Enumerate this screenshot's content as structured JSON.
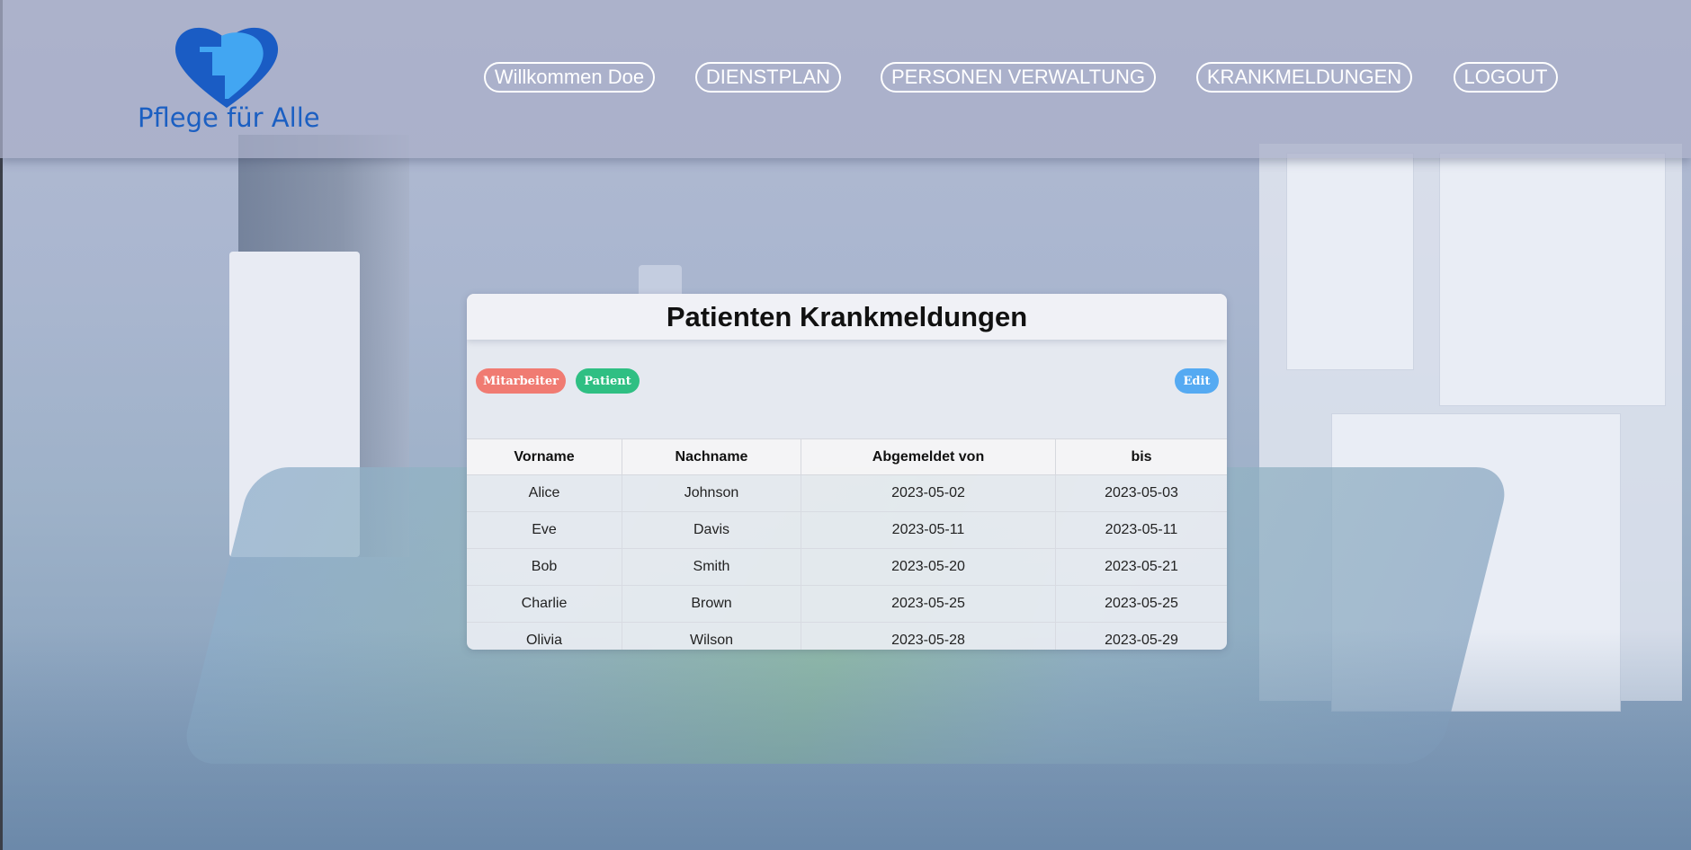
{
  "brand": {
    "name": "Pflege für Alle",
    "colors": {
      "heart_dark": "#1a5cc4",
      "heart_light": "#42a6f2",
      "text": "#1b5fc2"
    }
  },
  "nav": {
    "items": [
      {
        "label": "Willkommen Doe"
      },
      {
        "label": "DIENSTPLAN"
      },
      {
        "label": "PERSONEN VERWALTUNG"
      },
      {
        "label": "KRANKMELDUNGEN"
      },
      {
        "label": "LOGOUT"
      }
    ]
  },
  "card": {
    "title": "Patienten Krankmeldungen",
    "filters": {
      "mitarbeiter": {
        "label": "Mitarbeiter",
        "color": "#f07b72"
      },
      "patient": {
        "label": "Patient",
        "color": "#2fbf83"
      }
    },
    "edit": {
      "label": "Edit",
      "color": "#55aaf2"
    }
  },
  "table": {
    "columns": [
      "Vorname",
      "Nachname",
      "Abgemeldet von",
      "bis"
    ],
    "rows": [
      [
        "Alice",
        "Johnson",
        "2023-05-02",
        "2023-05-03"
      ],
      [
        "Eve",
        "Davis",
        "2023-05-11",
        "2023-05-11"
      ],
      [
        "Bob",
        "Smith",
        "2023-05-20",
        "2023-05-21"
      ],
      [
        "Charlie",
        "Brown",
        "2023-05-25",
        "2023-05-25"
      ],
      [
        "Olivia",
        "Wilson",
        "2023-05-28",
        "2023-05-29"
      ]
    ]
  }
}
